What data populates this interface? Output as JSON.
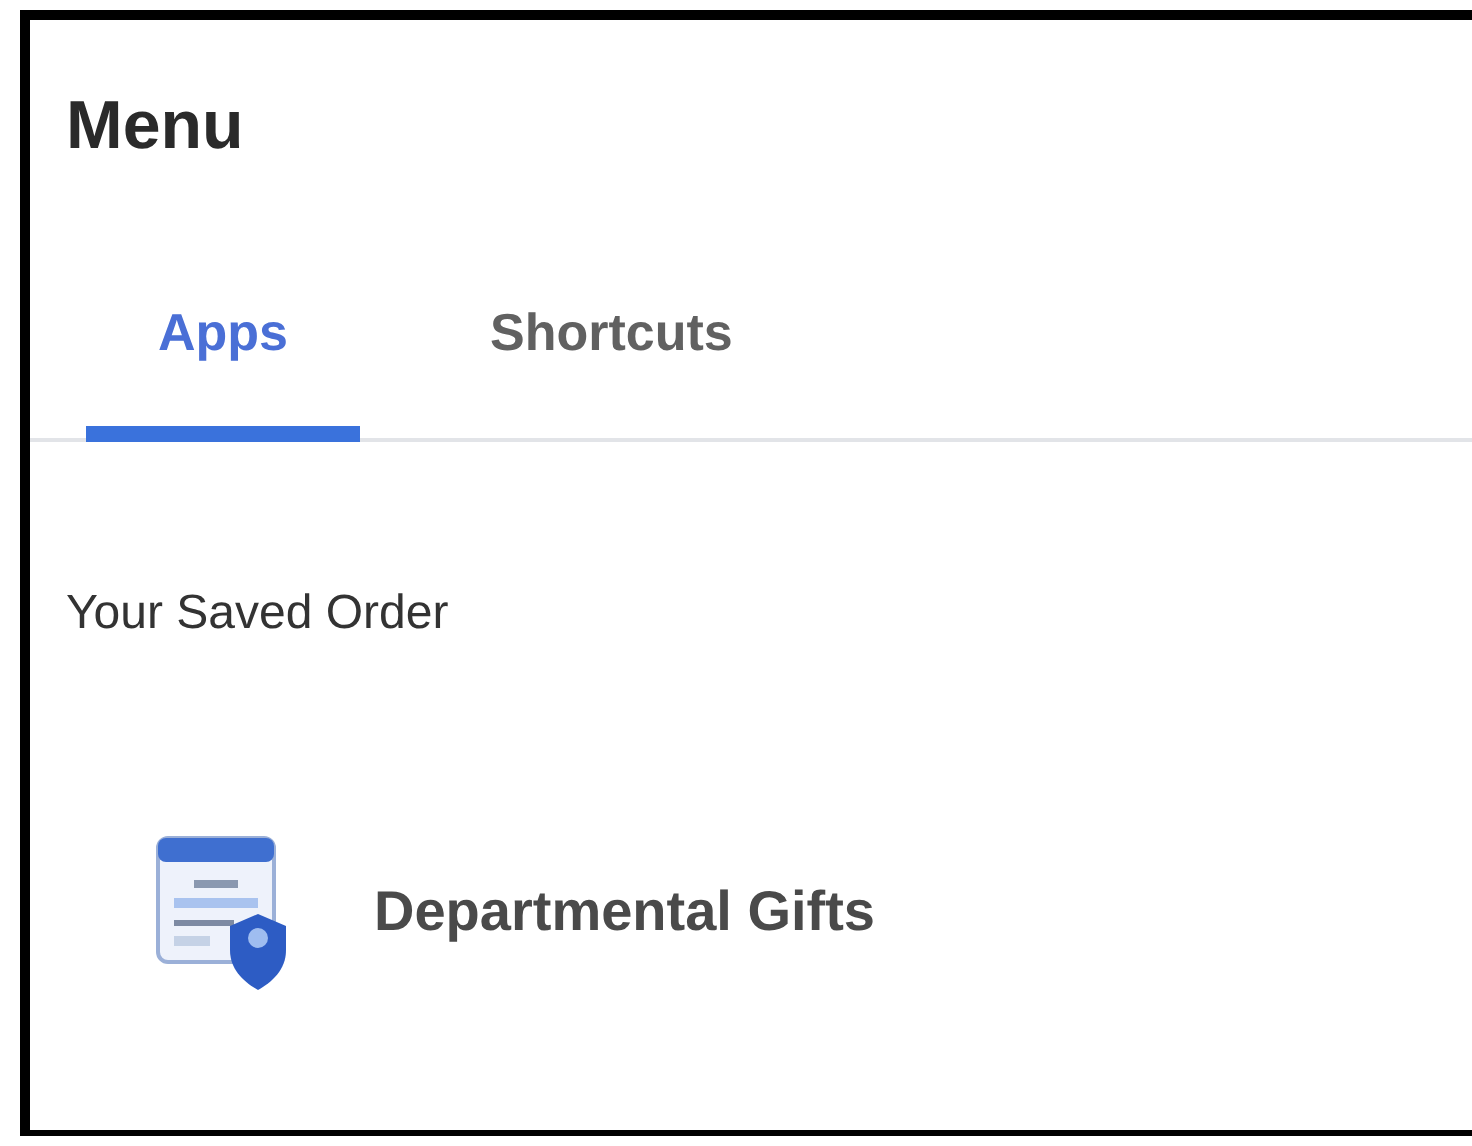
{
  "title": "Menu",
  "tabs": [
    {
      "label": "Apps",
      "selected": true
    },
    {
      "label": "Shortcuts",
      "selected": false
    }
  ],
  "section": {
    "heading": "Your Saved Order",
    "items": [
      {
        "label": "Departmental Gifts"
      }
    ]
  }
}
